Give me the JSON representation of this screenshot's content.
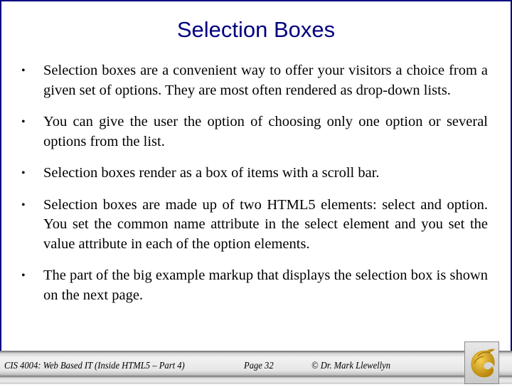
{
  "slide": {
    "title": "Selection Boxes",
    "bullets": [
      "Selection boxes are a convenient way to offer your visitors a choice from a given set of options.  They are most often rendered as drop-down lists.",
      "You can give the user the option of choosing only one option or several options from the list.",
      "Selection boxes render as a box of items with a scroll bar.",
      "Selection boxes are made up of two HTML5 elements: select and option.  You set the common name attribute in the select element and you set the value attribute in each of the option elements.",
      "The part of the big example markup that displays the selection box is shown on the next page."
    ],
    "bullet_glyph": "•"
  },
  "footer": {
    "course": "CIS 4004: Web Based IT (Inside HTML5 – Part 4)",
    "page": "Page 32",
    "author": "© Dr. Mark Llewellyn",
    "logo_icon": "pegasus-logo-icon"
  },
  "colors": {
    "title": "#000080",
    "frame": "#000080",
    "logo_gold": "#d4a017"
  }
}
